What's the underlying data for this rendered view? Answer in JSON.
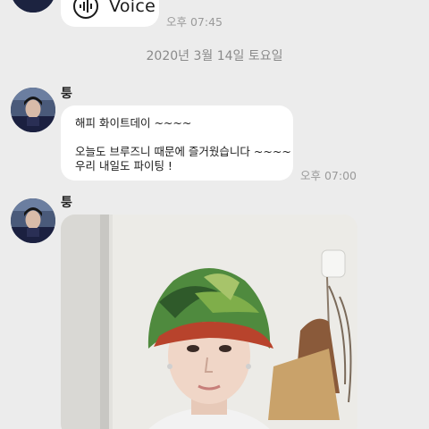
{
  "top_message": {
    "voice_label": "Voice",
    "time": "오후 07:45",
    "icon": "audio-waveform-icon"
  },
  "date_divider": "2020년 3월 14일 토요일",
  "messages": [
    {
      "sender": "퉁",
      "lines": [
        "해피 화이트데이 ~~~~",
        "",
        "오늘도 브루즈니 때문에 즐거웠습니다 ~~~~",
        "우리 내일도 파이팅 !"
      ],
      "time": "오후 07:00"
    },
    {
      "sender": "퉁",
      "type": "photo"
    }
  ],
  "colors": {
    "background": "#ececec",
    "bubble": "#ffffff",
    "timestamp": "#9a9a9a"
  }
}
